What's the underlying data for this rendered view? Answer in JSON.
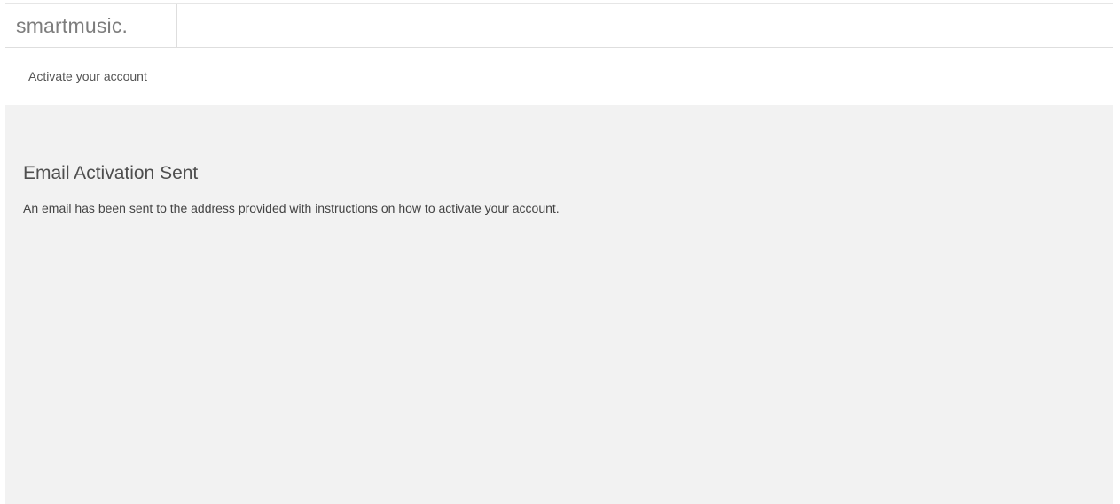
{
  "header": {
    "logo_text": "smartmusic."
  },
  "subheader": {
    "title": "Activate your account"
  },
  "main": {
    "heading": "Email Activation Sent",
    "message": "An email has been sent to the address provided with instructions on how to activate your account."
  },
  "colors": {
    "content_background": "#f2f2f2",
    "logo_text": "#7d7d7d",
    "border": "#dedede"
  }
}
